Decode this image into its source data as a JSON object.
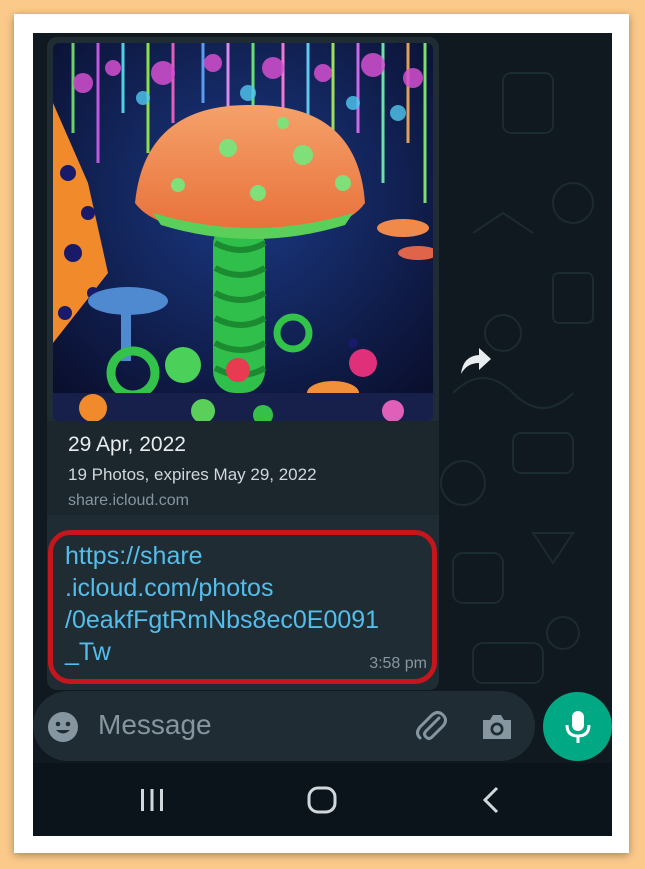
{
  "message": {
    "preview_title": "29 Apr, 2022",
    "preview_description": "19 Photos, expires May 29, 2022",
    "preview_domain": "share.icloud.com",
    "url_lines": [
      "https://share",
      ".icloud.com/photos",
      "/0eakfFgtRmNbs8ec0E0091",
      "_Tw"
    ],
    "time": "3:58 pm",
    "image_description": "psychedelic neon mushroom sculpture"
  },
  "composer": {
    "placeholder": "Message",
    "emoji_icon": "emoji-icon",
    "attach_icon": "paperclip-icon",
    "camera_icon": "camera-icon",
    "mic_icon": "microphone-icon"
  },
  "navigation": {
    "recents_icon": "recents-icon",
    "home_icon": "home-icon",
    "back_icon": "back-icon"
  },
  "colors": {
    "chat_background": "#0f191f",
    "bubble": "#1f2c33",
    "link": "#53bdeb",
    "accent_green": "#00a884",
    "highlight_red": "#c4161c",
    "frame_background": "#fbc98a"
  }
}
